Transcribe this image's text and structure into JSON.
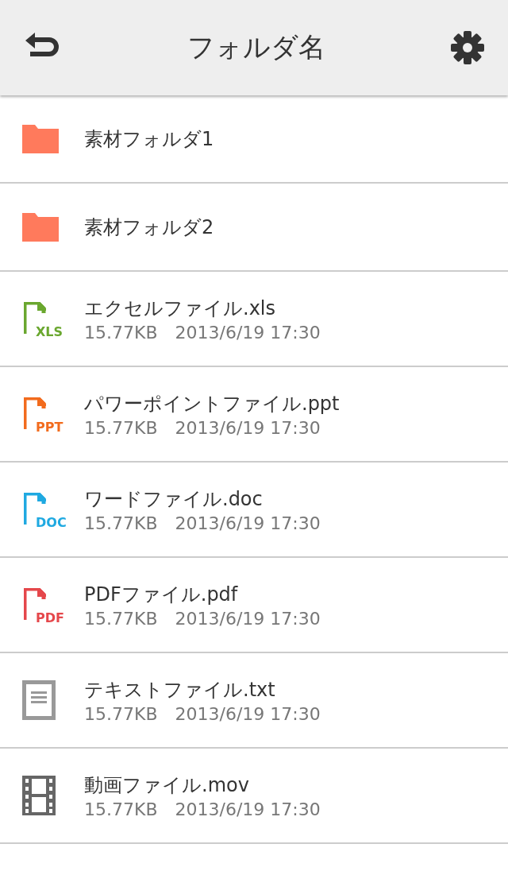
{
  "header": {
    "title": "フォルダ名"
  },
  "items": [
    {
      "kind": "folder",
      "name": "素材フォルダ1"
    },
    {
      "kind": "folder",
      "name": "素材フォルダ2"
    },
    {
      "kind": "document",
      "name": "エクセルファイル.xls",
      "badge": "XLS",
      "color": "#6aa72f",
      "size": "15.77KB",
      "date": "2013/6/19 17:30"
    },
    {
      "kind": "document",
      "name": "パワーポイントファイル.ppt",
      "badge": "PPT",
      "color": "#f26b1d",
      "size": "15.77KB",
      "date": "2013/6/19 17:30"
    },
    {
      "kind": "document",
      "name": "ワードファイル.doc",
      "badge": "DOC",
      "color": "#1fa9e1",
      "size": "15.77KB",
      "date": "2013/6/19 17:30"
    },
    {
      "kind": "document",
      "name": "PDFファイル.pdf",
      "badge": "PDF",
      "color": "#e5474b",
      "size": "15.77KB",
      "date": "2013/6/19 17:30"
    },
    {
      "kind": "text",
      "name": "テキストファイル.txt",
      "size": "15.77KB",
      "date": "2013/6/19 17:30"
    },
    {
      "kind": "video",
      "name": "動画ファイル.mov",
      "size": "15.77KB",
      "date": "2013/6/19 17:30"
    }
  ]
}
